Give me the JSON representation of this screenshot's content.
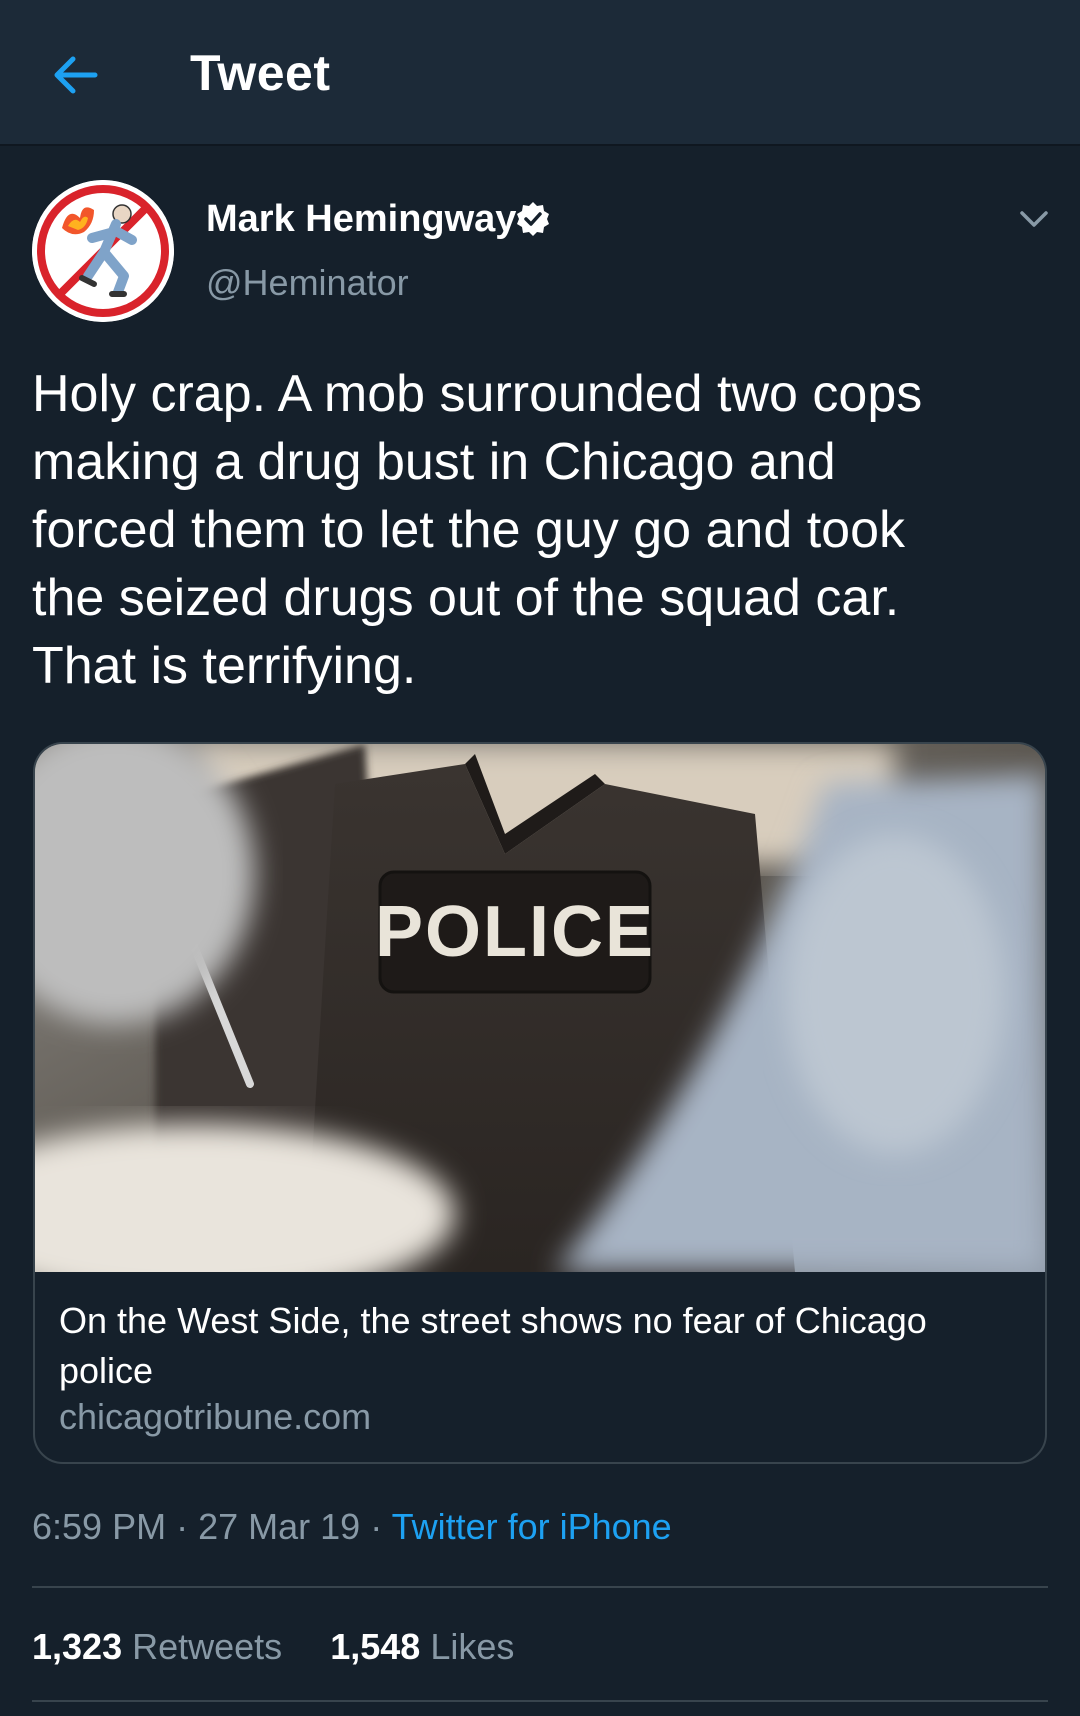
{
  "header": {
    "title": "Tweet",
    "back_icon": "arrow-left-icon",
    "accent": "#1da1f2"
  },
  "tweet": {
    "author_name": "Mark Hemingway",
    "author_handle": "@Heminator",
    "verified": true,
    "text": "Holy crap. A mob surrounded two cops\nmaking a drug bust in Chicago and\nforced them to let the guy go and took\nthe seized drugs out of the squad car.\nThat is terrifying.",
    "card": {
      "image_text": "POLICE",
      "title": "On the West Side, the street shows no fear of Chicago police",
      "domain": "chicagotribune.com"
    },
    "meta": {
      "time": "6:59 PM",
      "date": "27 Mar 19",
      "separator": "·",
      "source": "Twitter for iPhone"
    },
    "stats": {
      "retweets_count": "1,323",
      "retweets_label": "Retweets",
      "likes_count": "1,548",
      "likes_label": "Likes"
    }
  },
  "colors": {
    "background": "#15202b",
    "header": "#1c2a38",
    "secondary_text": "#8899a6",
    "link": "#1da1f2",
    "border": "#38444d"
  }
}
